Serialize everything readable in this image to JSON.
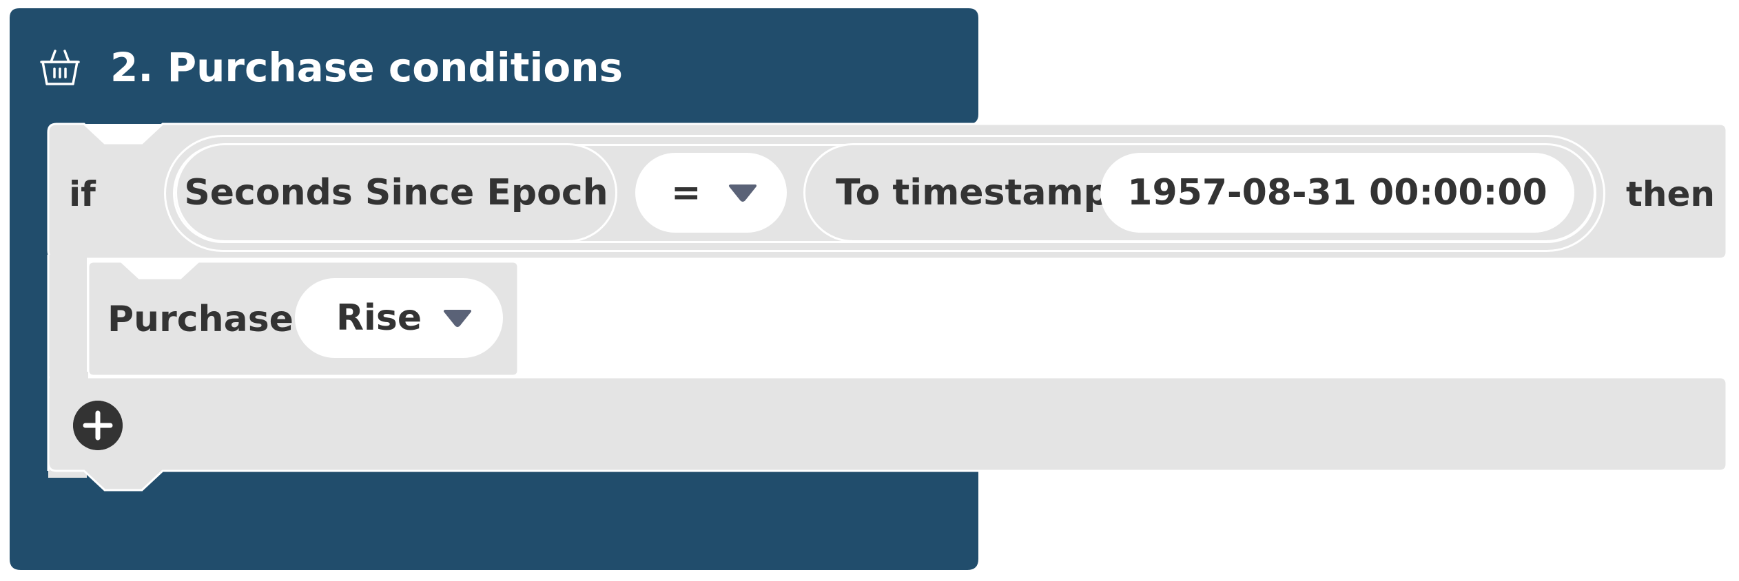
{
  "block": {
    "title": "2. Purchase conditions",
    "icon": "basket-icon",
    "colors": {
      "outer": "#214d6c",
      "statement": "#e4e4e4",
      "text": "#333333",
      "arrow": "#5a6277"
    }
  },
  "condition": {
    "if_label": "if",
    "then_label": "then",
    "left_operand": "Seconds Since Epoch",
    "operator": "=",
    "right_operand_label": "To timestamp",
    "timestamp_value": "1957-08-31 00:00:00"
  },
  "statement": {
    "label": "Purchase",
    "direction": "Rise"
  },
  "add_button": {
    "icon": "plus-icon"
  }
}
